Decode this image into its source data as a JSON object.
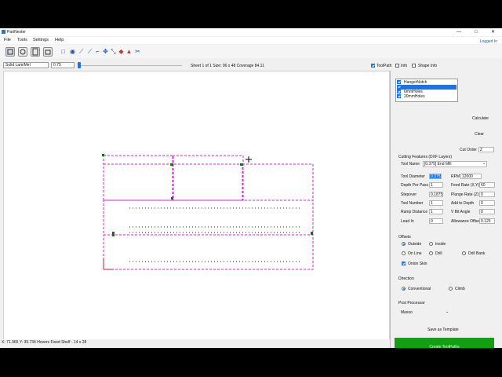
{
  "app": {
    "title": "PartNester",
    "login_link": "Logged In"
  },
  "menu": [
    "File",
    "Tools",
    "Settings",
    "Help"
  ],
  "window_controls": {
    "minimize": "—",
    "maximize": "□",
    "close": "✕"
  },
  "toolbar_icons": [
    "parts-icon",
    "settings-gear-icon",
    "sheet-icon",
    "template-icon",
    "rectangle-tool-icon",
    "circle-tool-icon",
    "line-tool-icon",
    "polyline-tool-icon",
    "selection-tool-icon",
    "move-tool-icon",
    "scale-tool-icon",
    "paint-tool-icon",
    "warning-tool-icon",
    "scissors-tool-icon"
  ],
  "options": {
    "material": "Solid Lam/Mel",
    "thickness": "0.75",
    "sheet_info": "Sheet 1 of 1 Size: 96 x 48 Coverage 84.11",
    "toolpath_label": "ToolPath",
    "info_label": "Info",
    "shape_info_label": "Shape Info",
    "toolpath_checked": true,
    "info_checked": false,
    "shape_info_checked": false
  },
  "status": {
    "text": "X: 71.965  Y: 35.734  Hovers Fixed Shelf - 14 x 28"
  },
  "layers": [
    {
      "label": "HangerNotch",
      "checked": true,
      "selected": false
    },
    {
      "label": "",
      "checked": true,
      "selected": true
    },
    {
      "label": "6mmHoles",
      "checked": true,
      "selected": false
    },
    {
      "label": "20mmHoles",
      "checked": true,
      "selected": false
    }
  ],
  "actions": {
    "calculate": "Calculate",
    "clear": "Clear",
    "cut_order_label": "Cut Order",
    "cut_order_value": "Z"
  },
  "cutting": {
    "section_title": "Cutting Features (DXF Layers)",
    "tool_name_label": "Tool Name",
    "tool_name_value": "[0.375] End Mill",
    "tool_diameter_label": "Tool Diameter",
    "tool_diameter_value": "0.375",
    "rpm_label": "RPM",
    "rpm_value": "12000",
    "depth_per_pass_label": "Depth Per Pass",
    "depth_per_pass_value": "1",
    "feed_rate_label": "Feed Rate (X,Y)",
    "feed_rate_value": "60",
    "stepover_label": "Stepover",
    "stepover_value": "0.1875",
    "plunge_rate_label": "Plunge Rate (Z)",
    "plunge_rate_value": "0",
    "tool_number_label": "Tool Number",
    "tool_number_value": "1",
    "add_to_depth_label": "Add to Depth",
    "add_to_depth_value": "0",
    "ramp_distance_label": "Ramp Distance",
    "ramp_distance_value": "1",
    "vbit_angle_label": "V Bit Angle",
    "vbit_angle_value": "0",
    "lead_in_label": "Lead In",
    "lead_in_value": "0",
    "allowance_offset_label": "Allowance Offset",
    "allowance_offset_value": "0.125"
  },
  "offsets": {
    "title": "Offsets",
    "outside": "Outside",
    "inside": "Inside",
    "on_line": "On Line",
    "drill": "Drill",
    "drill_bank": "Drill Bank",
    "onion_skin": "Onion Skin",
    "selected": "outside",
    "onion_skin_checked": true
  },
  "direction": {
    "title": "Direction",
    "conventional": "Conventional",
    "climb": "Climb",
    "selected": "conventional"
  },
  "post_processor": {
    "title": "Post Processor",
    "value": "Masso"
  },
  "buttons": {
    "save_template": "Save as Template",
    "create_toolpaths": "Create ToolPaths"
  },
  "colors": {
    "toolpath": "#e01ee0",
    "create_button": "#12a012",
    "accent": "#1a73e8"
  }
}
